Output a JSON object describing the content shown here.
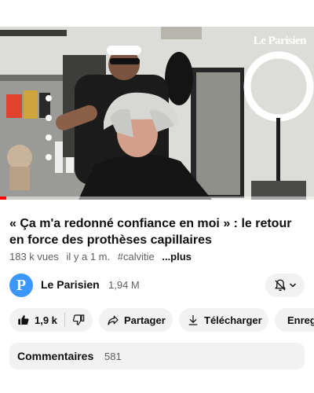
{
  "video": {
    "watermark": "Le Parisien",
    "progress": 0.02
  },
  "title": "« Ça m'a redonné confiance en moi » : le retour en force des prothèses capillaires",
  "meta": {
    "views": "183 k vues",
    "age": "il y a 1 m.",
    "hashtag": "#calvitie",
    "more": "...plus"
  },
  "channel": {
    "avatar_letter": "P",
    "name": "Le Parisien",
    "subscribers": "1,94 M"
  },
  "actions": {
    "likes": "1,9 k",
    "share": "Partager",
    "download": "Télécharger",
    "save": "Enregistrer"
  },
  "comments": {
    "label": "Commentaires",
    "count": "581"
  },
  "colors": {
    "progress": "#ff0000",
    "avatar": "#3b97ff",
    "pill_bg": "#f2f2f2",
    "secondary_text": "#606060"
  }
}
